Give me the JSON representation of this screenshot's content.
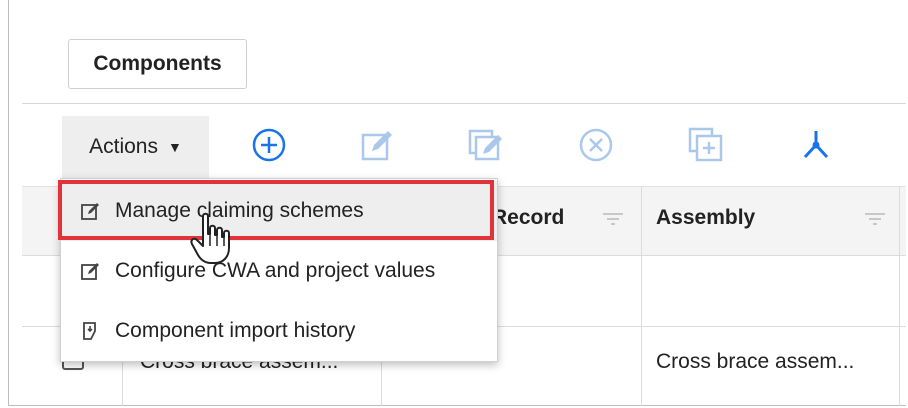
{
  "tabs": {
    "components_label": "Components"
  },
  "toolbar": {
    "actions_label": "Actions",
    "caret": "▼",
    "icons": [
      "add-icon",
      "edit-icon",
      "bulk-edit-icon",
      "delete-icon",
      "copy-icon",
      "split-icon"
    ]
  },
  "grid": {
    "columns": [
      "Record",
      "Assembly"
    ],
    "rows": [
      {
        "name": "",
        "assembly": ""
      },
      {
        "name": "Cross brace assem...",
        "assembly": "Cross brace assem..."
      }
    ]
  },
  "menu": {
    "items": [
      {
        "label": "Manage claiming schemes",
        "icon": "edit-icon"
      },
      {
        "label": "Configure CWA and project values",
        "icon": "edit-icon"
      },
      {
        "label": "Component import history",
        "icon": "history-icon"
      }
    ]
  },
  "colors": {
    "accent": "#1a73e8",
    "highlight": "#e0343a",
    "disabled_icon": "#a9c8ec"
  }
}
